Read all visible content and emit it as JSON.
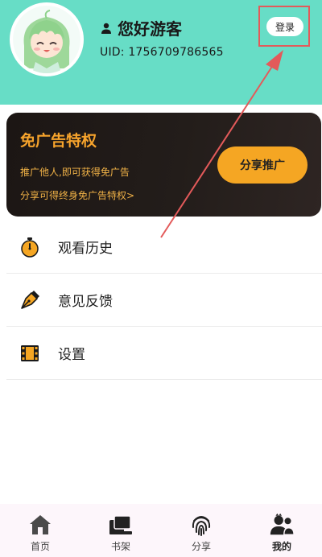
{
  "header": {
    "user_name": "您好游客",
    "uid": "UID: 1756709786565",
    "login_label": "登录",
    "bg_color": "#67ddc6",
    "user_icon": "person-icon",
    "avatar_icon": "anime-girl-avatar"
  },
  "promo": {
    "title": "免广告特权",
    "line1": "推广他人,即可获得免广告",
    "line2": "分享可得终身免广告特权>",
    "button_label": "分享推广",
    "accent_color": "#f5a623"
  },
  "menu": {
    "items": [
      {
        "label": "观看历史",
        "icon": "stopwatch-icon"
      },
      {
        "label": "意见反馈",
        "icon": "pen-nib-icon"
      },
      {
        "label": "设置",
        "icon": "film-icon"
      }
    ]
  },
  "bottom_nav": {
    "items": [
      {
        "label": "首页",
        "icon": "home-icon"
      },
      {
        "label": "书架",
        "icon": "bookshelf-icon"
      },
      {
        "label": "分享",
        "icon": "fingerprint-icon"
      },
      {
        "label": "我的",
        "icon": "users-icon",
        "active": true
      }
    ]
  },
  "annotation": {
    "highlight_color": "#e35a5a"
  }
}
